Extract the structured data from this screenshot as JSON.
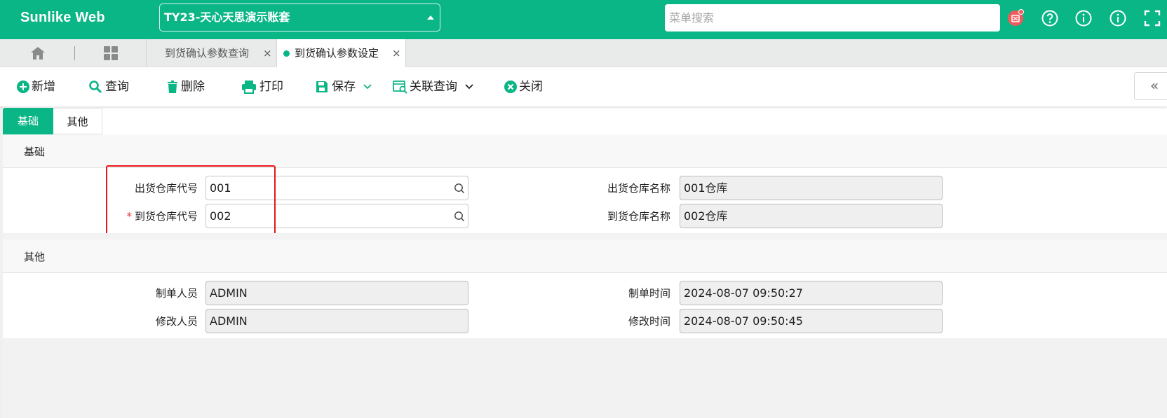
{
  "header": {
    "brand": "Sunlike Web",
    "account": "TY23-天心天思演示账套",
    "search_placeholder": "菜单搜索",
    "icons": [
      "notification-badge-icon",
      "help-icon",
      "info-icon",
      "info-icon",
      "fullscreen-icon"
    ]
  },
  "tabs": {
    "home_icon": "home-icon",
    "apps_icon": "apps-grid-icon",
    "items": [
      {
        "label": "到货确认参数查询",
        "close": "×",
        "active": false
      },
      {
        "label": "到货确认参数设定",
        "close": "×",
        "active": true
      }
    ]
  },
  "toolbar": {
    "add": "新增",
    "query": "查询",
    "delete": "删除",
    "print": "打印",
    "save": "保存",
    "related_query": "关联查询",
    "close": "关闭",
    "collapse": "«"
  },
  "subtabs": [
    "基础",
    "其他"
  ],
  "sections": {
    "basic": {
      "title": "基础",
      "fields": {
        "out_wh_code_label": "出货仓库代号",
        "out_wh_code": "001",
        "out_wh_name_label": "出货仓库名称",
        "out_wh_name": "001仓库",
        "in_wh_code_required": "*",
        "in_wh_code_label": "到货仓库代号",
        "in_wh_code": "002",
        "in_wh_name_label": "到货仓库名称",
        "in_wh_name": "002仓库"
      }
    },
    "other": {
      "title": "其他",
      "fields": {
        "creator_label": "制单人员",
        "creator": "ADMIN",
        "create_time_label": "制单时间",
        "create_time": "2024-08-07 09:50:27",
        "modifier_label": "修改人员",
        "modifier": "ADMIN",
        "modify_time_label": "修改时间",
        "modify_time": "2024-08-07 09:50:45"
      }
    }
  },
  "colors": {
    "accent": "#0ab586",
    "highlight": "#e8161b",
    "badge": "#f05a5a"
  }
}
